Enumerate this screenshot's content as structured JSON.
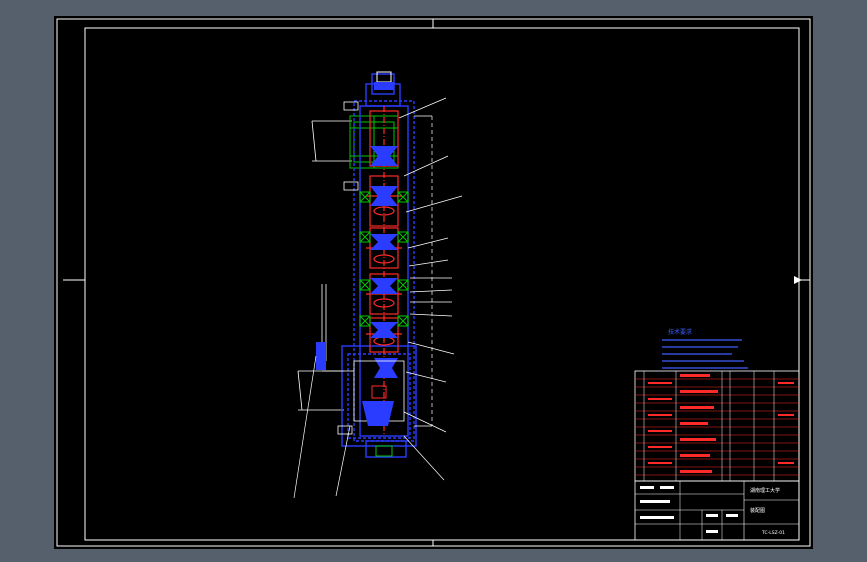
{
  "colors": {
    "background": "#56606d",
    "sheet": "#000000",
    "frame": "#ffffff",
    "housing": "#2a3cff",
    "gear": "#ff2a2a",
    "shaft": "#00c800",
    "leader": "#ffffff",
    "notes": "#3c5cff"
  },
  "notes": {
    "heading": "技术要求"
  },
  "title_block": {
    "school": "湖南理工大学",
    "drawing_title": "装配图",
    "drawing_number": "TC-LSZ-01"
  },
  "icons": [
    "crosshair-marker"
  ]
}
